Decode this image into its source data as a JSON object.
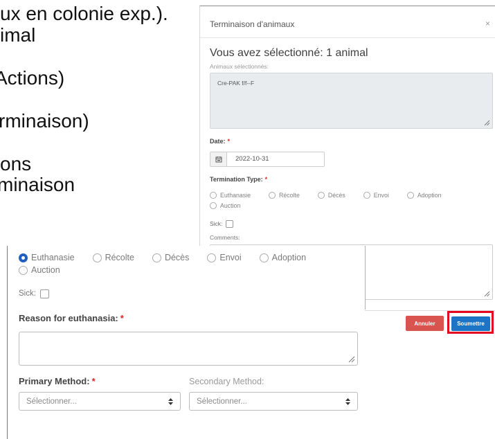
{
  "document_excerpt": {
    "lines": [
      "ux en colonie exp.).",
      "imal",
      "Actions)",
      "rminaison)",
      "ons",
      "minaison"
    ]
  },
  "modal": {
    "title": "Terminaison d'animaux",
    "close_label": "×",
    "heading": "Vous avez sélectionné: 1 animal",
    "selected_label": "Animaux sélectionnés:",
    "selected_value": "Cre-PAK f/f--F",
    "date_label": "Date:",
    "required_mark": "*",
    "date_value": "2022-10-31",
    "termination_label": "Termination Type:",
    "termination_options": [
      "Euthanasie",
      "Récolte",
      "Décès",
      "Envoi",
      "Adoption",
      "Auction"
    ],
    "termination_selected_index": null,
    "sick_label": "Sick:",
    "sick_checked": false,
    "comments_label": "Comments:",
    "cancel_label": "Annuler",
    "submit_label": "Soumettre"
  },
  "zoom_panel": {
    "termination_options": [
      "Euthanasie",
      "Récolte",
      "Décès",
      "Envoi",
      "Adoption",
      "Auction"
    ],
    "termination_selected_index": 0,
    "sick_label": "Sick:",
    "sick_checked": false,
    "reason_label": "Reason for euthanasia:",
    "required_mark": "*",
    "primary_method_label": "Primary Method:",
    "primary_method_placeholder": "Sélectionner...",
    "secondary_method_label": "Secondary Method:",
    "secondary_method_placeholder": "Sélectionner..."
  },
  "icons": {
    "close": "close-icon",
    "calendar": "calendar-icon",
    "resize": "resize-handle-icon",
    "select": "select-arrows-icon"
  },
  "colors": {
    "submit": "#1b74c5",
    "cancel": "#d9534f",
    "highlight": "#e3061e",
    "required": "#e02424",
    "selected_radio": "#1f5fbf",
    "readonly_field": "#e9ecef"
  }
}
